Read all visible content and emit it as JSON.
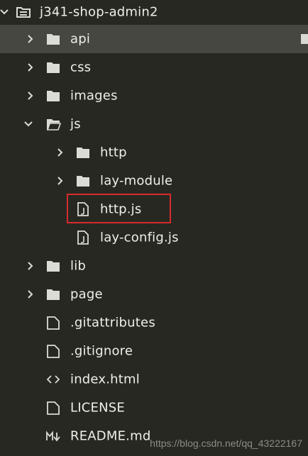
{
  "tree": {
    "root": {
      "label": "j341-shop-admin2",
      "icon": "folder-open-icon",
      "state": "expanded"
    },
    "items": [
      {
        "label": "api",
        "type": "folder",
        "icon": "folder-icon",
        "state": "collapsed",
        "selected": true
      },
      {
        "label": "css",
        "type": "folder",
        "icon": "folder-icon",
        "state": "collapsed"
      },
      {
        "label": "images",
        "type": "folder",
        "icon": "folder-icon",
        "state": "collapsed"
      },
      {
        "label": "js",
        "type": "folder",
        "icon": "folder-open-icon",
        "state": "expanded"
      },
      {
        "label": "http",
        "type": "folder",
        "icon": "folder-icon",
        "state": "collapsed"
      },
      {
        "label": "lay-module",
        "type": "folder",
        "icon": "folder-icon",
        "state": "collapsed"
      },
      {
        "label": "http.js",
        "type": "file",
        "icon": "js-file-icon",
        "highlighted": true
      },
      {
        "label": "lay-config.js",
        "type": "file",
        "icon": "js-file-icon"
      },
      {
        "label": "lib",
        "type": "folder",
        "icon": "folder-icon",
        "state": "collapsed"
      },
      {
        "label": "page",
        "type": "folder",
        "icon": "folder-icon",
        "state": "collapsed"
      },
      {
        "label": ".gitattributes",
        "type": "file",
        "icon": "file-icon"
      },
      {
        "label": ".gitignore",
        "type": "file",
        "icon": "file-icon"
      },
      {
        "label": "index.html",
        "type": "file",
        "icon": "code-icon"
      },
      {
        "label": "LICENSE",
        "type": "file",
        "icon": "file-icon"
      },
      {
        "label": "README.md",
        "type": "file",
        "icon": "markdown-icon"
      }
    ]
  },
  "watermark": "https://blog.csdn.net/qq_43222167",
  "colors": {
    "background": "#272822",
    "selected_row": "#464741",
    "highlight_border": "#d62b2b",
    "icon": "#dcdcd6",
    "text": "#efefe9"
  }
}
